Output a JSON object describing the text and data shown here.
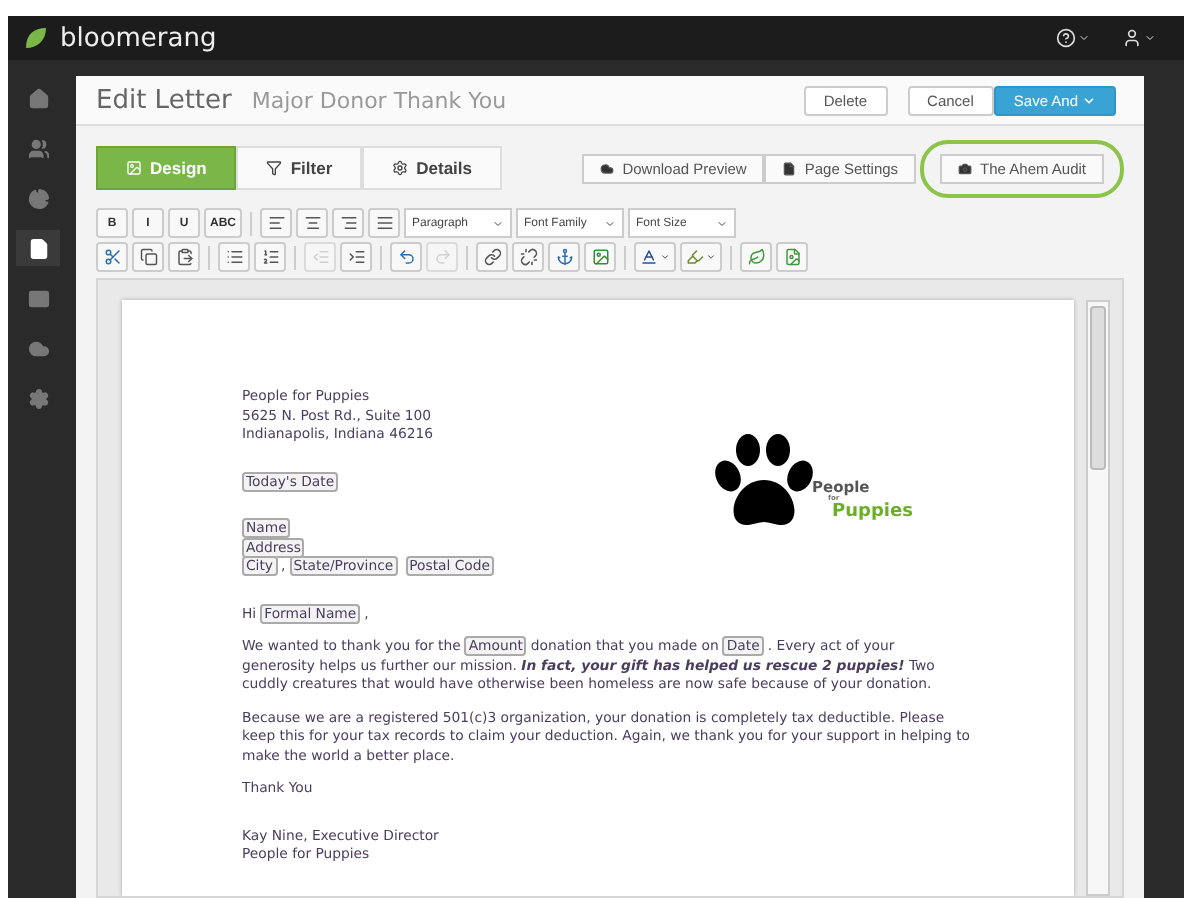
{
  "app": {
    "name": "bloomerang"
  },
  "header_menus": [
    {
      "kind": "help"
    },
    {
      "kind": "user"
    }
  ],
  "sidebar": {
    "items": [
      {
        "kind": "home",
        "selected": false
      },
      {
        "kind": "people",
        "selected": false
      },
      {
        "kind": "chart",
        "selected": false
      },
      {
        "kind": "letters",
        "selected": true
      },
      {
        "kind": "mail",
        "selected": false
      },
      {
        "kind": "cloud",
        "selected": false
      },
      {
        "kind": "settings",
        "selected": false
      }
    ]
  },
  "page": {
    "title": "Edit Letter",
    "subtitle": "Major Donor Thank You"
  },
  "actions": [
    {
      "label": "Delete",
      "kind": "plain"
    },
    {
      "label": "Cancel",
      "kind": "plain"
    },
    {
      "label": "Save And",
      "kind": "primary"
    }
  ],
  "tabs": [
    {
      "label": "Design",
      "selected": true
    },
    {
      "label": "Filter",
      "selected": false
    },
    {
      "label": "Details",
      "selected": false
    }
  ],
  "tools": [
    {
      "label": "Download Preview",
      "highlighted": false
    },
    {
      "label": "Page Settings",
      "highlighted": false
    },
    {
      "label": "The Ahem Audit",
      "highlighted": true
    }
  ],
  "toolbar_row_1": [
    {
      "kind": "text",
      "label": "B"
    },
    {
      "kind": "text",
      "label": "I"
    },
    {
      "kind": "text",
      "label": "U"
    },
    {
      "kind": "text",
      "label": "ABC"
    },
    {
      "kind": "sep"
    },
    {
      "kind": "align-left"
    },
    {
      "kind": "align-center"
    },
    {
      "kind": "align-right"
    },
    {
      "kind": "align-justify"
    },
    {
      "kind": "select",
      "label": "Paragraph"
    },
    {
      "kind": "select",
      "label": "Font Family"
    },
    {
      "kind": "select",
      "label": "Font Size"
    }
  ],
  "toolbar_row_2": [
    {
      "kind": "cut"
    },
    {
      "kind": "copy"
    },
    {
      "kind": "paste"
    },
    {
      "kind": "sep"
    },
    {
      "kind": "bullets"
    },
    {
      "kind": "numbers"
    },
    {
      "kind": "sep"
    },
    {
      "kind": "outdent",
      "disabled": true
    },
    {
      "kind": "indent",
      "disabled": false
    },
    {
      "kind": "sep"
    },
    {
      "kind": "undo",
      "disabled": false
    },
    {
      "kind": "redo",
      "disabled": true
    },
    {
      "kind": "sep"
    },
    {
      "kind": "link"
    },
    {
      "kind": "unlink"
    },
    {
      "kind": "anchor"
    },
    {
      "kind": "image"
    },
    {
      "kind": "sep"
    },
    {
      "kind": "text-color"
    },
    {
      "kind": "highlight"
    },
    {
      "kind": "sep"
    },
    {
      "kind": "leaf"
    },
    {
      "kind": "leaf-doc"
    }
  ],
  "letter": {
    "logo": {
      "line_1": "People",
      "line_2": "for",
      "line_3": "Puppies"
    },
    "blocks": [
      {
        "gap": false,
        "lines": [
          [
            {
              "kind": "text",
              "text": "People for Puppies"
            }
          ],
          [
            {
              "kind": "text",
              "text": "5625 N. Post Rd., Suite 100"
            }
          ],
          [
            {
              "kind": "text",
              "text": "Indianapolis, Indiana 46216"
            }
          ]
        ]
      },
      {
        "gap": true,
        "lines": [
          [
            {
              "kind": "field",
              "text": "Today's Date"
            }
          ]
        ]
      },
      {
        "gap": true,
        "lines": [
          [
            {
              "kind": "field",
              "text": "Name"
            }
          ],
          [
            {
              "kind": "field",
              "text": "Address"
            }
          ],
          [
            {
              "kind": "field",
              "text": "City"
            },
            {
              "kind": "text",
              "text": ","
            },
            {
              "kind": "field",
              "text": "State/Province"
            },
            {
              "kind": "field",
              "text": "Postal Code"
            }
          ]
        ]
      },
      {
        "gap": true,
        "lines": [
          [
            {
              "kind": "text",
              "text": "Hi"
            },
            {
              "kind": "field",
              "text": "Formal Name"
            },
            {
              "kind": "text",
              "text": ","
            }
          ]
        ]
      },
      {
        "gap": false,
        "lines": [
          [
            {
              "kind": "text",
              "text": "We wanted to thank you for the"
            },
            {
              "kind": "field",
              "text": "Amount"
            },
            {
              "kind": "text",
              "text": "donation that you made on"
            },
            {
              "kind": "field",
              "text": "Date"
            },
            {
              "kind": "text",
              "text": ". Every act of your generosity helps us further our mission. "
            },
            {
              "kind": "emphasis",
              "text": "In fact, your gift has helped us rescue 2 puppies!"
            },
            {
              "kind": "text",
              "text": " Two cuddly creatures that would have otherwise been homeless are now safe because of your donation."
            }
          ]
        ]
      },
      {
        "gap": false,
        "lines": [
          [
            {
              "kind": "text",
              "text": "Because we are a registered 501(c)3 organization, your donation is completely tax deductible. Please keep this for your tax records to claim your deduction. Again, we thank you for your support in helping to make the world a better place."
            }
          ]
        ]
      },
      {
        "gap": false,
        "lines": [
          [
            {
              "kind": "text",
              "text": "Thank You"
            }
          ]
        ]
      },
      {
        "gap": true,
        "lines": [
          [
            {
              "kind": "text",
              "text": "Kay Nine, Executive Director"
            }
          ],
          [
            {
              "kind": "text",
              "text": "People for Puppies"
            }
          ]
        ]
      }
    ]
  }
}
